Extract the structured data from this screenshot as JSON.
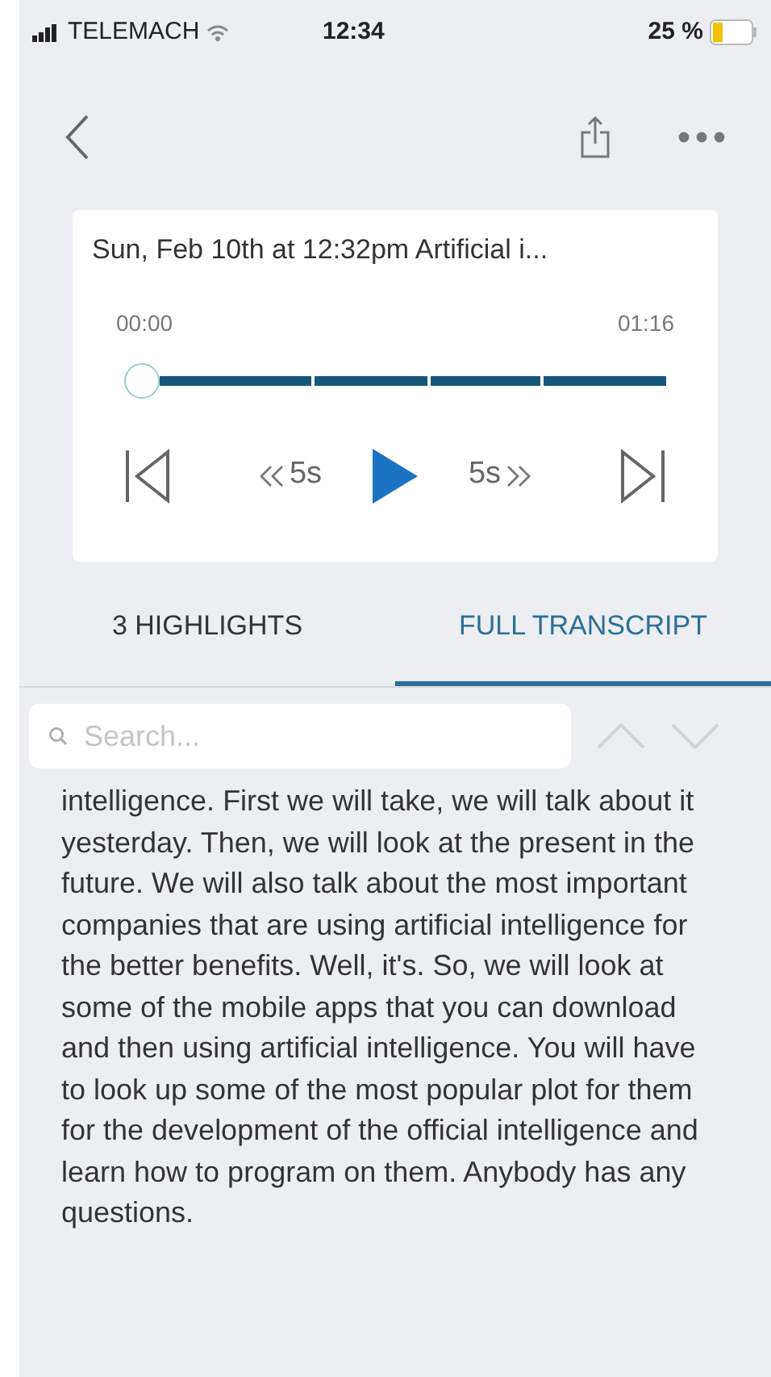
{
  "status_bar": {
    "carrier": "TELEMACH",
    "time": "12:34",
    "battery": "25 %"
  },
  "player": {
    "title": "Sun, Feb 10th at 12:32pm Artificial i...",
    "elapsed": "00:00",
    "duration": "01:16",
    "level": 0,
    "playing": false,
    "skip_back": "5s",
    "skip_forward": "5s"
  },
  "tabs": [
    {
      "label": "3 HIGHLIGHTS",
      "selected": false
    },
    {
      "label": "FULL TRANSCRIPT",
      "selected": true
    }
  ],
  "search": {
    "placeholder": "Search..."
  },
  "transcript": "intelligence. First we will take, we will talk about it yesterday. Then, we will look at the present in the future. We will also talk about the most important companies that are using artificial intelligence for the better benefits. Well, it's. So, we will look at some of the mobile apps that you can download and then using artificial intelligence. You will have to look up some of the most popular plot for them for the development of the official intelligence and learn how to program on them. Anybody has any questions."
}
